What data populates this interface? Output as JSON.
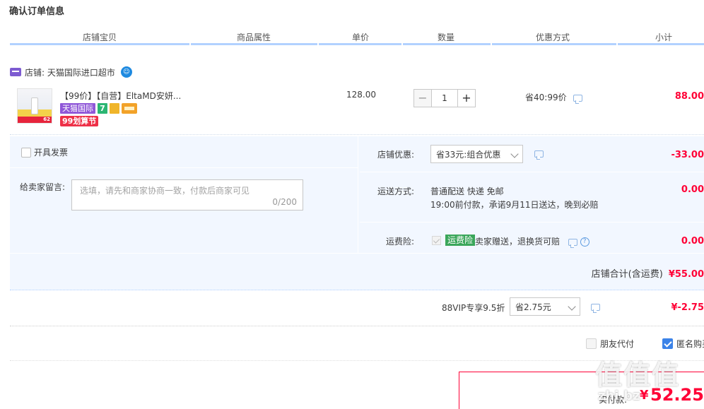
{
  "page_title": "确认订单信息",
  "columns": [
    "店铺宝贝",
    "商品属性",
    "单价",
    "数量",
    "优惠方式",
    "小计"
  ],
  "shop": {
    "label": "店铺: 天猫国际进口超市",
    "ww_icon": "aliwangwang-icon"
  },
  "item": {
    "title": "【99价】【自营】EltaMD安妍...",
    "thumb_price": "62",
    "badges": {
      "tmall": "天猫国际",
      "sq_green": "7",
      "festival": "99划算节"
    },
    "unit_price": "128.00",
    "qty_minus": "−",
    "qty": "1",
    "qty_plus": "+",
    "promo": "省40:99价",
    "subtotal": "88.00"
  },
  "invoice": {
    "label": "开具发票"
  },
  "message": {
    "label": "给卖家留言:",
    "placeholder": "选填，请先和商家协商一致，付款后商家可见",
    "count": "0/200"
  },
  "shop_discount": {
    "label": "店铺优惠:",
    "selected": "省33元:组合优惠",
    "value": "-33.00"
  },
  "shipping": {
    "label": "运送方式:",
    "line1": "普通配送 快递 免邮",
    "line2": "19:00前付款，承诺9月11日送达，晚到必赔",
    "value": "0.00"
  },
  "insurance": {
    "label": "运费险:",
    "tag": "运费险",
    "text": "卖家赠送，退换货可赔",
    "help": "?",
    "value": "0.00"
  },
  "shop_total": {
    "label": "店铺合计(含运费)",
    "value": "¥55.00"
  },
  "vip": {
    "label": "88VIP专享9.5折",
    "selected": "省2.75元",
    "value": "¥-2.75"
  },
  "payment": {
    "friend_pay": "朋友代付",
    "anonymous": "匿名购买"
  },
  "final": {
    "label": "实付款:",
    "currency": "¥",
    "value": "52.25"
  },
  "watermark": {
    "text": "值值值",
    "url": "zhi.bz"
  },
  "colors": {
    "accent": "#ff0036",
    "line": "#b2d1ff",
    "panel": "#f2f7ff",
    "tmall_purple": "#8f57d8"
  }
}
